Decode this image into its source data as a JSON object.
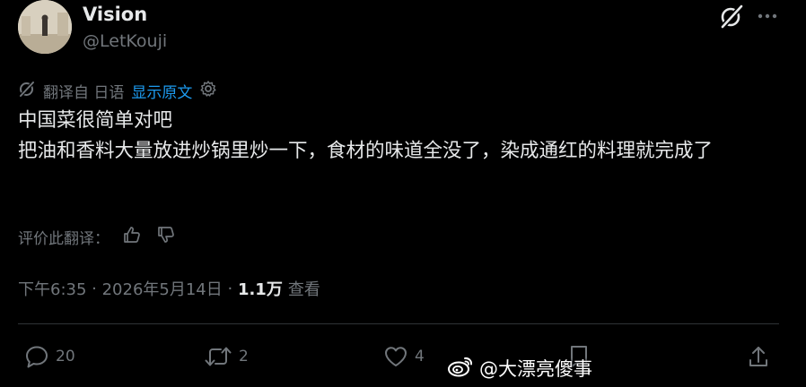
{
  "author": {
    "display_name": "Vision",
    "handle": "@LetKouji"
  },
  "header_icons": {
    "grok": "grok-icon",
    "more": "more-icon"
  },
  "translation": {
    "source_label": "翻译自 日语",
    "show_original_label": "显示原文",
    "settings_icon": "gear-icon"
  },
  "tweet": {
    "text": "中国菜很简单对吧\n把油和香料大量放进炒锅里炒一下，食材的味道全没了，染成通红的料理就完成了"
  },
  "rate_translation": {
    "label": "评价此翻译："
  },
  "meta": {
    "time": "下午6:35",
    "separator1": " · ",
    "date": "2026年5月14日",
    "separator2": " · ",
    "view_count": "1.1万",
    "view_label": "查看"
  },
  "actions": {
    "reply_count": "20",
    "retweet_count": "2",
    "like_count": "4"
  },
  "watermark": {
    "text": "@大漂亮傻事"
  },
  "colors": {
    "background": "#000000",
    "text": "#e7e9ea",
    "muted": "#71767b",
    "link": "#1d9bf0",
    "divider": "#2f3336"
  }
}
